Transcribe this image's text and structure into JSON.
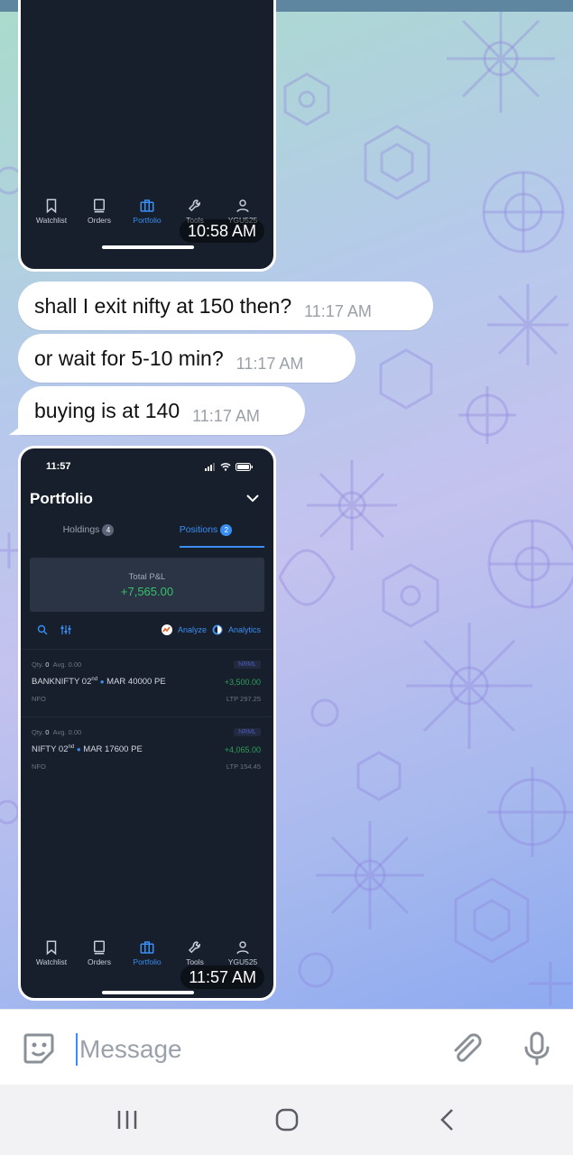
{
  "colors": {
    "bubble": "#ffffff",
    "app_bg": "#171f2c",
    "accent": "#3a8ef2",
    "profit": "#35c26a"
  },
  "screenshot1": {
    "tabs": [
      "Watchlist",
      "Orders",
      "Portfolio",
      "Tools",
      "YGU525"
    ],
    "time": "10:58 AM"
  },
  "messages": [
    {
      "text": "shall I exit nifty at 150 then?",
      "time": "11:17 AM"
    },
    {
      "text": "or wait for 5-10 min?",
      "time": "11:17 AM"
    },
    {
      "text": "buying is at 140",
      "time": "11:17 AM"
    }
  ],
  "screenshot2": {
    "status_time": "11:57",
    "title": "Portfolio",
    "tabs": [
      {
        "label": "Holdings",
        "count": "4"
      },
      {
        "label": "Positions",
        "count": "2"
      }
    ],
    "pnl_label": "Total P&L",
    "pnl_value": "+7,565.00",
    "analyze": "Analyze",
    "analytics": "Analytics",
    "positions": [
      {
        "qty_label": "Qty.",
        "qty": "0",
        "avg": "Avg. 0.00",
        "product": "NRML",
        "symbol": "BANKNIFTY 02",
        "sup": "nd",
        "contract": "MAR 40000 PE",
        "pnl": "+3,500.00",
        "exchange": "NFO",
        "ltp": "LTP 297.25"
      },
      {
        "qty_label": "Qty.",
        "qty": "0",
        "avg": "Avg. 0.00",
        "product": "NRML",
        "symbol": "NIFTY 02",
        "sup": "nd",
        "contract": "MAR 17600 PE",
        "pnl": "+4,065.00",
        "exchange": "NFO",
        "ltp": "LTP 154.45"
      }
    ],
    "tabs_bottom": [
      "Watchlist",
      "Orders",
      "Portfolio",
      "Tools",
      "YGU525"
    ],
    "time": "11:57 AM"
  },
  "composer": {
    "placeholder": "Message"
  }
}
